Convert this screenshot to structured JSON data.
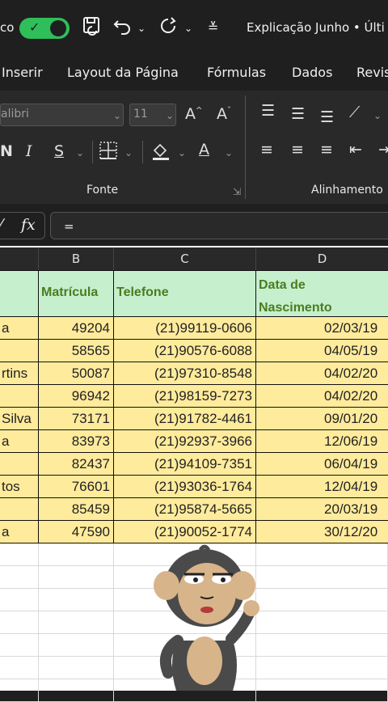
{
  "titlebar": {
    "autosave_label": "co",
    "doc_title": "Explicação Junho • Últi",
    "icons": [
      "save-icon",
      "undo-icon",
      "redo-icon",
      "customize-icon"
    ]
  },
  "menu": [
    "Inserir",
    "Layout da Página",
    "Fórmulas",
    "Dados",
    "Revis"
  ],
  "ribbon": {
    "font_name": "alibri",
    "font_size": "11",
    "grow_font": "A",
    "shrink_font": "A",
    "bold": "N",
    "italic": "I",
    "underline": "S",
    "font_color": "A",
    "group_font": "Fonte",
    "group_alignment": "Alinhamento"
  },
  "formula": {
    "fx": "fx",
    "value": "="
  },
  "columns": [
    "B",
    "C",
    "D"
  ],
  "headers": {
    "a": "",
    "matricula": "Matrícula",
    "telefone": "Telefone",
    "nascimento_1": "Data de",
    "nascimento_2": "Nascimento"
  },
  "rows": [
    {
      "name": "a",
      "mat": "49204",
      "tel": "(21)99119-0606",
      "date": "02/03/19"
    },
    {
      "name": "",
      "mat": "58565",
      "tel": "(21)90576-6088",
      "date": "04/05/19"
    },
    {
      "name": "rtins",
      "mat": "50087",
      "tel": "(21)97310-8548",
      "date": "04/02/20"
    },
    {
      "name": "",
      "mat": "96942",
      "tel": "(21)98159-7273",
      "date": "04/02/20"
    },
    {
      "name": "Silva",
      "mat": "73171",
      "tel": "(21)91782-4461",
      "date": "09/01/20"
    },
    {
      "name": "a",
      "mat": "83973",
      "tel": "(21)92937-3966",
      "date": "12/06/19"
    },
    {
      "name": "",
      "mat": "82437",
      "tel": "(21)94109-7351",
      "date": "06/04/19"
    },
    {
      "name": "tos",
      "mat": "76601",
      "tel": "(21)93036-1764",
      "date": "12/04/19"
    },
    {
      "name": "",
      "mat": "85459",
      "tel": "(21)95874-5665",
      "date": "20/03/19"
    },
    {
      "name": "a",
      "mat": "47590",
      "tel": "(21)90052-1774",
      "date": "30/12/20"
    }
  ],
  "colors": {
    "header_fill": "#c6efce",
    "header_text": "#4a7d1f",
    "data_fill": "#ffeb9c",
    "toggle": "#2fbf5a"
  }
}
